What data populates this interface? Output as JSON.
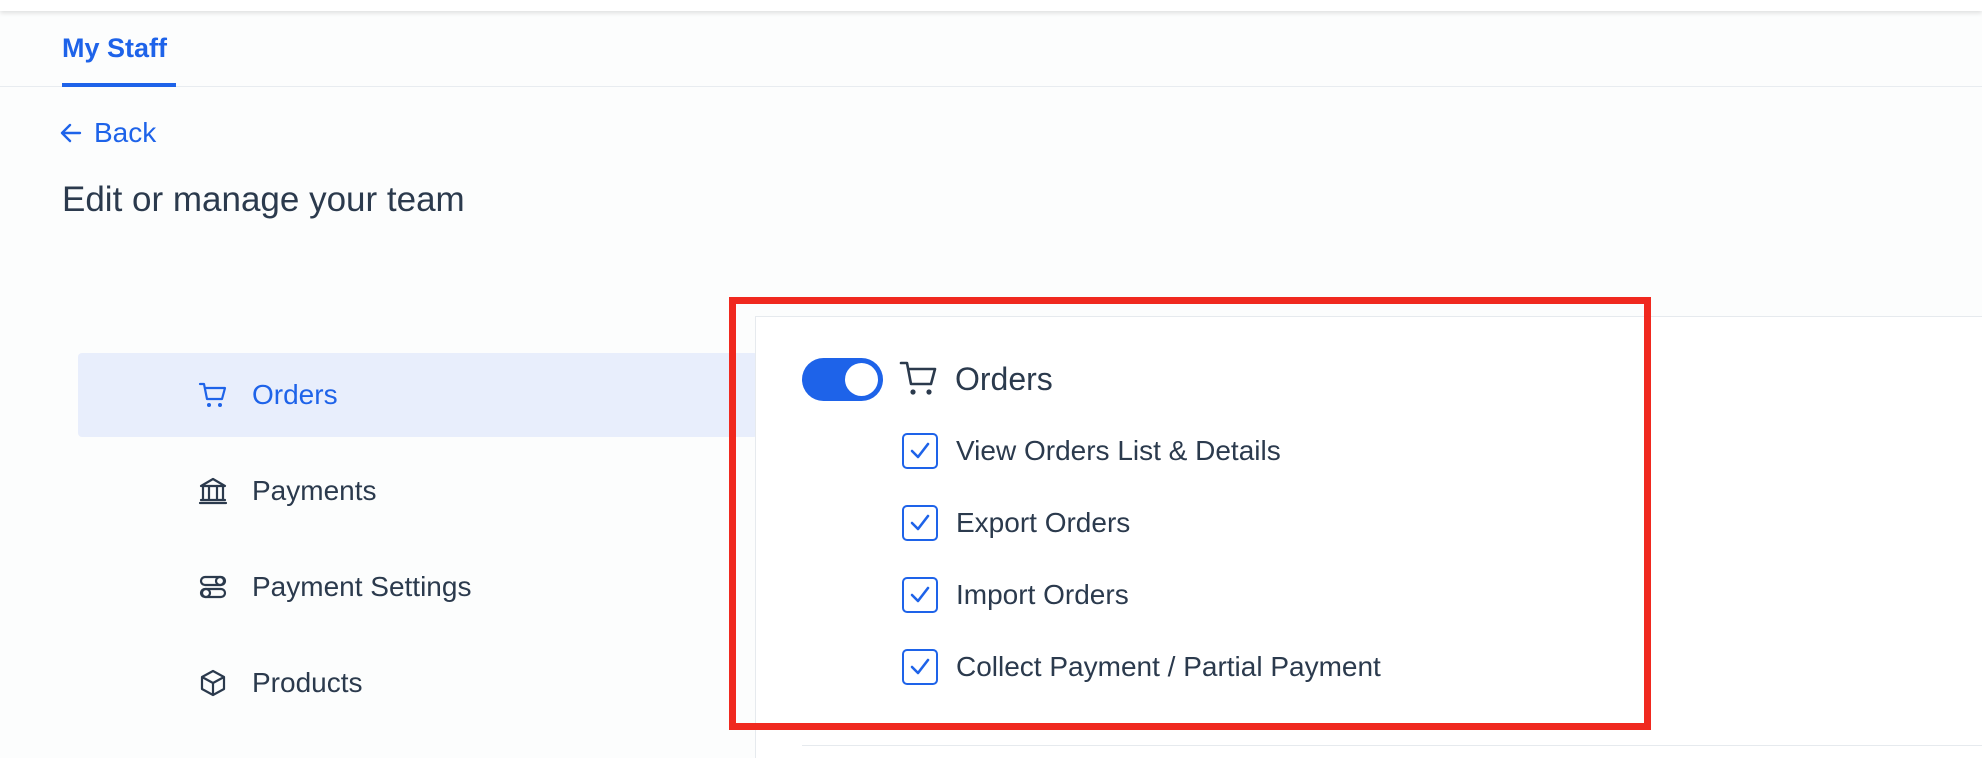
{
  "tabs": {
    "active_label": "My Staff"
  },
  "nav": {
    "back_label": "Back"
  },
  "page": {
    "title": "Edit or manage your team"
  },
  "sidebar": {
    "items": [
      {
        "label": "Orders",
        "icon": "cart-icon",
        "active": true
      },
      {
        "label": "Payments",
        "icon": "bank-icon",
        "active": false
      },
      {
        "label": "Payment Settings",
        "icon": "settings-toggle-icon",
        "active": false
      },
      {
        "label": "Products",
        "icon": "box-icon",
        "active": false
      }
    ]
  },
  "permissions": {
    "group_title": "Orders",
    "group_enabled": true,
    "items": [
      {
        "label": "View Orders List & Details",
        "checked": true
      },
      {
        "label": "Export Orders",
        "checked": true
      },
      {
        "label": "Import Orders",
        "checked": true
      },
      {
        "label": "Collect Payment / Partial Payment",
        "checked": true
      }
    ]
  },
  "colors": {
    "accent": "#1e63e9",
    "highlight": "#f0291f",
    "active_bg": "#e8eefc",
    "text": "#2b3a4d"
  }
}
